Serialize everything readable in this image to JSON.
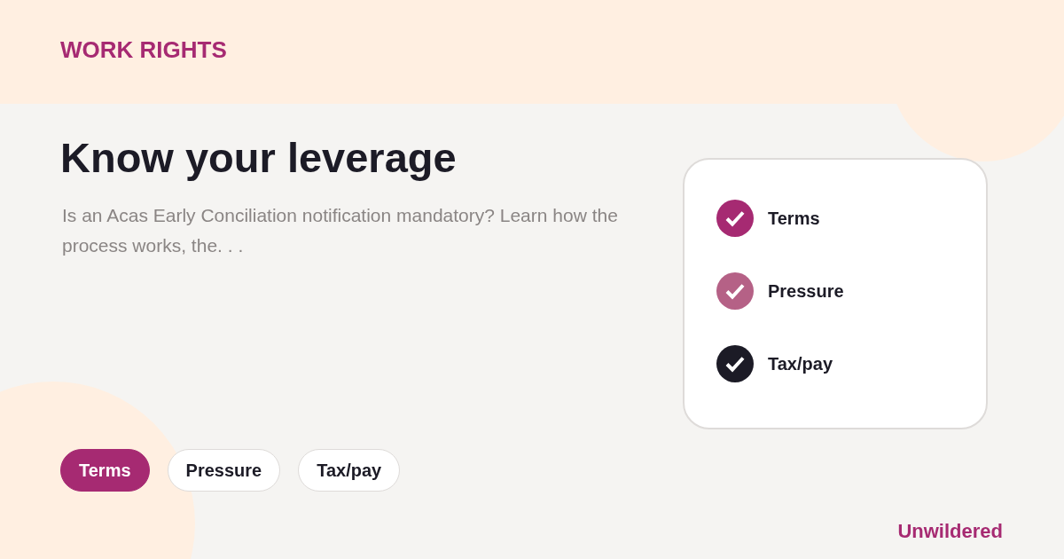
{
  "eyebrow": "WORK RIGHTS",
  "title": "Know your leverage",
  "description": "Is an Acas Early Conciliation notification mandatory? Learn how the process works, the. . .",
  "checklist": [
    {
      "label": "Terms",
      "checked": true,
      "color": "#a62a72"
    },
    {
      "label": "Pressure",
      "checked": true,
      "color": "#b56186"
    },
    {
      "label": "Tax/pay",
      "checked": true,
      "color": "#1c1b26"
    }
  ],
  "pills": [
    {
      "label": "Terms",
      "selected": true
    },
    {
      "label": "Pressure",
      "selected": false
    },
    {
      "label": "Tax/pay",
      "selected": false
    }
  ],
  "brand": "Unwildered"
}
